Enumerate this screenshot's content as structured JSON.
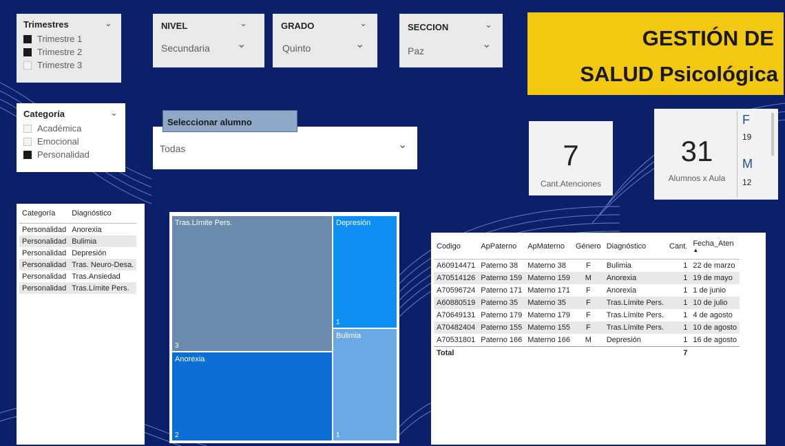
{
  "slicers": {
    "trimestres": {
      "title": "Trimestres",
      "options": [
        {
          "label": "Trimestre 1",
          "checked": true
        },
        {
          "label": "Trimestre 2",
          "checked": true
        },
        {
          "label": "Trimestre 3",
          "checked": false
        }
      ]
    },
    "nivel": {
      "title": "NIVEL",
      "value": "Secundaria"
    },
    "grado": {
      "title": "GRADO",
      "value": "Quinto"
    },
    "seccion": {
      "title": "SECCION",
      "value": "Paz"
    },
    "categoria": {
      "title": "Categoría",
      "options": [
        {
          "label": "Académica",
          "checked": false
        },
        {
          "label": "Emocional",
          "checked": false
        },
        {
          "label": "Personalidad",
          "checked": true
        }
      ]
    },
    "alumno": {
      "title": "Seleccionar alumno",
      "value": "Todas"
    }
  },
  "title_banner": {
    "line1": "GESTIÓN DE",
    "line2": "SALUD Psicológica",
    "color": "#f2c811"
  },
  "cards": {
    "atenciones": {
      "value": "7",
      "label": "Cant.Atenciones"
    },
    "alumnos": {
      "value": "31",
      "label": "Alumnos x Aula",
      "f_label": "F",
      "f_value": "19",
      "m_label": "M",
      "m_value": "12"
    }
  },
  "category_table": {
    "headers": [
      "Categoría",
      "Diagnóstico"
    ],
    "rows": [
      [
        "Personalidad",
        "Anorexia"
      ],
      [
        "Personalidad",
        "Bulimia"
      ],
      [
        "Personalidad",
        "Depresión"
      ],
      [
        "Personalidad",
        "Tras. Neuro-Desa."
      ],
      [
        "Personalidad",
        "Tras.Ansiedad"
      ],
      [
        "Personalidad",
        "Tras.Límite Pers."
      ]
    ]
  },
  "treemap": {
    "items": [
      {
        "label": "Tras.Límite Pers.",
        "value": 3,
        "color": "#6b8bae"
      },
      {
        "label": "Anorexia",
        "value": 2,
        "color": "#0b6fd6"
      },
      {
        "label": "Depresión",
        "value": 1,
        "color": "#0d8ff5"
      },
      {
        "label": "Bulimia",
        "value": 1,
        "color": "#6aa8e6"
      }
    ]
  },
  "detail_table": {
    "headers": [
      "Codigo",
      "ApPaterno",
      "ApMaterno",
      "Género",
      "Diagnóstico",
      "Cant.",
      "Fecha_Aten"
    ],
    "sort_indicator": "▲",
    "rows": [
      [
        "A60914471",
        "Paterno 38",
        "Materno 38",
        "F",
        "Bulimia",
        "1",
        "22 de marzo"
      ],
      [
        "A70514126",
        "Paterno 159",
        "Materno 159",
        "M",
        "Anorexia",
        "1",
        "19 de mayo"
      ],
      [
        "A70596724",
        "Paterno 171",
        "Materno 171",
        "F",
        "Anorexia",
        "1",
        "1 de junio"
      ],
      [
        "A60880519",
        "Paterno 35",
        "Materno 35",
        "F",
        "Tras.Límite Pers.",
        "1",
        "10 de julio"
      ],
      [
        "A70649131",
        "Paterno 179",
        "Materno 179",
        "F",
        "Tras.Límite Pers.",
        "1",
        "4 de agosto"
      ],
      [
        "A70482404",
        "Paterno 155",
        "Materno 155",
        "F",
        "Tras.Límite Pers.",
        "1",
        "10 de agosto"
      ],
      [
        "A70531801",
        "Paterno 166",
        "Materno 166",
        "M",
        "Depresión",
        "1",
        "16 de agosto"
      ]
    ],
    "total_label": "Total",
    "total_value": "7"
  },
  "icons": {
    "chevron": "chevron-down-icon",
    "checkbox": "checkbox-icon"
  }
}
